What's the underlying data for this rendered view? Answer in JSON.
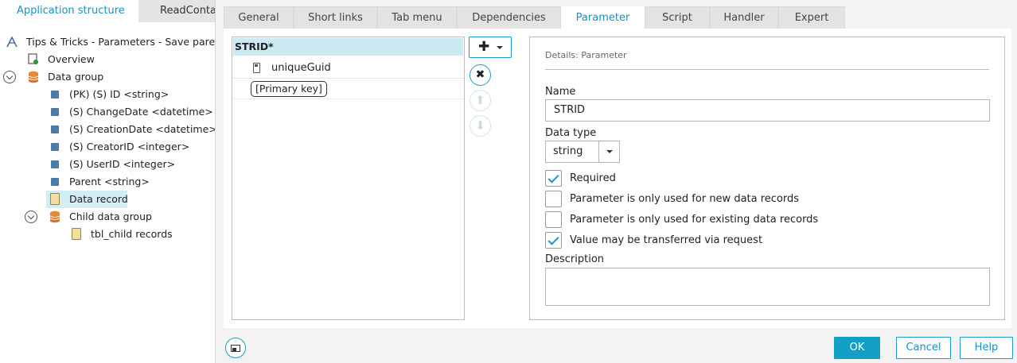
{
  "left_panel": {
    "tabs": [
      "Application structure",
      "ReadContai"
    ],
    "tree": [
      {
        "label": "Tips & Tricks - Parameters - Save parent",
        "icon": "app-icon"
      },
      {
        "label": "Overview",
        "icon": "document-icon"
      },
      {
        "label": "Data group",
        "icon": "database-icon"
      },
      {
        "label": "(PK) (S) ID <string>",
        "icon": "field-icon"
      },
      {
        "label": "(S) ChangeDate <datetime>",
        "icon": "field-icon"
      },
      {
        "label": "(S) CreationDate <datetime>",
        "icon": "field-icon"
      },
      {
        "label": "(S) CreatorID <integer>",
        "icon": "field-icon"
      },
      {
        "label": "(S) UserID <integer>",
        "icon": "field-icon"
      },
      {
        "label": "Parent <string>",
        "icon": "field-icon"
      },
      {
        "label": "Data record",
        "icon": "record-icon",
        "selected": true
      },
      {
        "label": "Child data group",
        "icon": "database-icon"
      },
      {
        "label": "tbl_child records",
        "icon": "record-icon"
      }
    ]
  },
  "dialog": {
    "tabs": [
      "General",
      "Short links",
      "Tab menu",
      "Dependencies",
      "Parameter",
      "Script",
      "Handler",
      "Expert"
    ],
    "active_tab": "Parameter",
    "param_list": {
      "header": "STRID*",
      "item_value": "uniqueGuid",
      "item_badge": "[Primary key]"
    },
    "details": {
      "title": "Details: Parameter",
      "name_label": "Name",
      "name_value": "STRID",
      "datatype_label": "Data type",
      "datatype_value": "string",
      "checkboxes": [
        {
          "label": "Required",
          "checked": true
        },
        {
          "label": "Parameter is only used for new data records",
          "checked": false
        },
        {
          "label": "Parameter is only used for existing data records",
          "checked": false
        },
        {
          "label": "Value may be transferred via request",
          "checked": true
        }
      ],
      "description_label": "Description",
      "description_value": ""
    },
    "footer": {
      "ok": "OK",
      "cancel": "Cancel",
      "help": "Help"
    }
  },
  "colors": {
    "accent": "#1a9cc8",
    "selection": "#cdeaf2",
    "ok_bg": "#14a0c6"
  }
}
